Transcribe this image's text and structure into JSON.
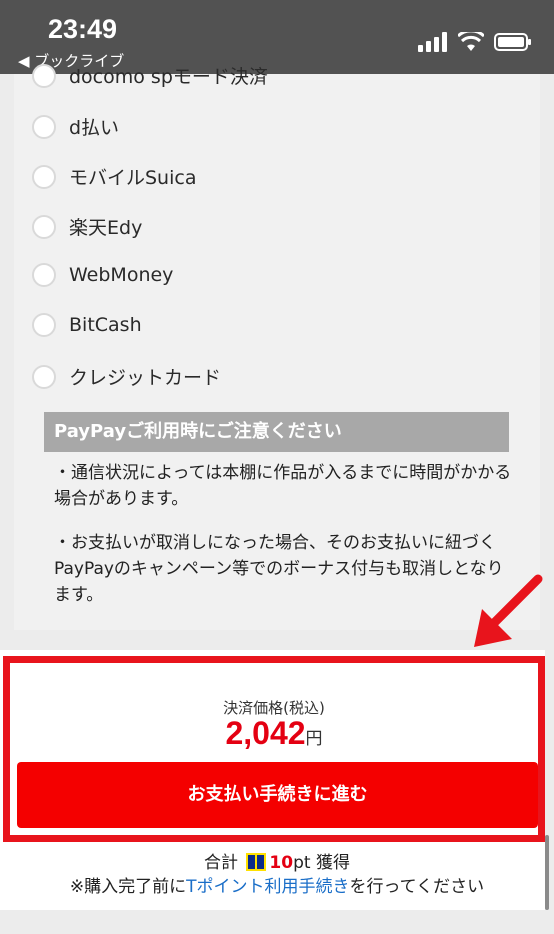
{
  "status": {
    "time": "23:49",
    "back_label": "◀ ブックライブ"
  },
  "payment_options": [
    {
      "label": "docomo spモード決済"
    },
    {
      "label": "d払い"
    },
    {
      "label": "モバイルSuica"
    },
    {
      "label": "楽天Edy"
    },
    {
      "label": "WebMoney"
    },
    {
      "label": "BitCash"
    },
    {
      "label": "クレジットカード"
    }
  ],
  "notice_box": {
    "title": "PayPayご利用時にご注意ください",
    "item1": "・通信状況によっては本棚に作品が入るまでに時間がかかる場合があります。",
    "item2": "・お支払いが取消しになった場合、そのお支払いに紐づくPayPayのキャンペーン等でのボーナス付与も取消しとなります。"
  },
  "checkout": {
    "price_label": "決済価格(税込)",
    "price": "2,042",
    "price_unit": "円",
    "button": "お支払い手続きに進む"
  },
  "points": {
    "prefix": "合計",
    "value": "10",
    "unit": "pt",
    "suffix": "獲得"
  },
  "t_notice": {
    "pre": "※購入完了前に",
    "link": "Tポイント利用手続き",
    "post": "を行ってください"
  },
  "colors": {
    "accent": "#e8141c",
    "button": "#f40000",
    "link": "#1a6ec8"
  }
}
